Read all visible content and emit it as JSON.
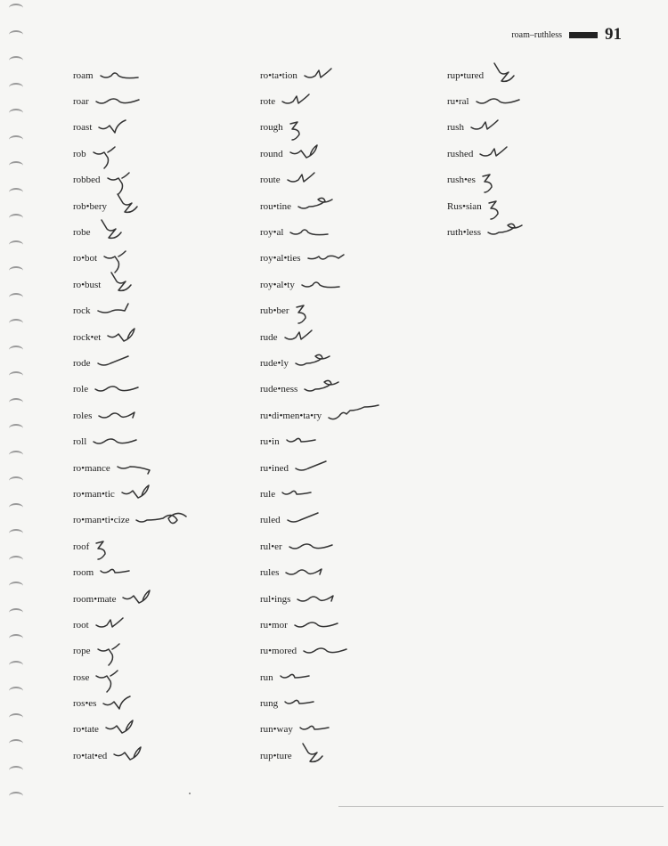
{
  "header": {
    "range": "roam–ruthless",
    "page_number": "91"
  },
  "columns": [
    [
      {
        "word": "roam",
        "stroke": "s1"
      },
      {
        "word": "roar",
        "stroke": "s2"
      },
      {
        "word": "roast",
        "stroke": "s3"
      },
      {
        "word": "rob",
        "stroke": "s4"
      },
      {
        "word": "robbed",
        "stroke": "s4"
      },
      {
        "word": "rob•bery",
        "stroke": "s5"
      },
      {
        "word": "robe",
        "stroke": "s5"
      },
      {
        "word": "ro•bot",
        "stroke": "s4"
      },
      {
        "word": "ro•bust",
        "stroke": "s5"
      },
      {
        "word": "rock",
        "stroke": "s6"
      },
      {
        "word": "rock•et",
        "stroke": "s7"
      },
      {
        "word": "rode",
        "stroke": "s8"
      },
      {
        "word": "role",
        "stroke": "s2"
      },
      {
        "word": "roles",
        "stroke": "s9"
      },
      {
        "word": "roll",
        "stroke": "s2"
      },
      {
        "word": "ro•mance",
        "stroke": "s10"
      },
      {
        "word": "ro•man•tic",
        "stroke": "s7"
      },
      {
        "word": "ro•man•ti•cize",
        "stroke": "s11"
      },
      {
        "word": "roof",
        "stroke": "s12"
      },
      {
        "word": "room",
        "stroke": "s13"
      },
      {
        "word": "room•mate",
        "stroke": "s7"
      },
      {
        "word": "root",
        "stroke": "s14"
      },
      {
        "word": "rope",
        "stroke": "s4"
      },
      {
        "word": "rose",
        "stroke": "s4"
      },
      {
        "word": "ros•es",
        "stroke": "s3"
      },
      {
        "word": "ro•tate",
        "stroke": "s7"
      },
      {
        "word": "ro•tat•ed",
        "stroke": "s7"
      }
    ],
    [
      {
        "word": "ro•ta•tion",
        "stroke": "s14"
      },
      {
        "word": "rote",
        "stroke": "s14"
      },
      {
        "word": "rough",
        "stroke": "s12"
      },
      {
        "word": "round",
        "stroke": "s7"
      },
      {
        "word": "route",
        "stroke": "s14"
      },
      {
        "word": "rou•tine",
        "stroke": "s15"
      },
      {
        "word": "roy•al",
        "stroke": "s1"
      },
      {
        "word": "roy•al•ties",
        "stroke": "s16"
      },
      {
        "word": "roy•al•ty",
        "stroke": "s1"
      },
      {
        "word": "rub•ber",
        "stroke": "s12"
      },
      {
        "word": "rude",
        "stroke": "s14"
      },
      {
        "word": "rude•ly",
        "stroke": "s15"
      },
      {
        "word": "rude•ness",
        "stroke": "s15"
      },
      {
        "word": "ru•di•men•ta•ry",
        "stroke": "s17"
      },
      {
        "word": "ru•in",
        "stroke": "s13"
      },
      {
        "word": "ru•ined",
        "stroke": "s8"
      },
      {
        "word": "rule",
        "stroke": "s13"
      },
      {
        "word": "ruled",
        "stroke": "s8"
      },
      {
        "word": "rul•er",
        "stroke": "s2"
      },
      {
        "word": "rules",
        "stroke": "s9"
      },
      {
        "word": "rul•ings",
        "stroke": "s9"
      },
      {
        "word": "ru•mor",
        "stroke": "s2"
      },
      {
        "word": "ru•mored",
        "stroke": "s2"
      },
      {
        "word": "run",
        "stroke": "s13"
      },
      {
        "word": "rung",
        "stroke": "s13"
      },
      {
        "word": "run•way",
        "stroke": "s13"
      },
      {
        "word": "rup•ture",
        "stroke": "s5"
      }
    ],
    [
      {
        "word": "rup•tured",
        "stroke": "s5"
      },
      {
        "word": "ru•ral",
        "stroke": "s2"
      },
      {
        "word": "rush",
        "stroke": "s14"
      },
      {
        "word": "rushed",
        "stroke": "s14"
      },
      {
        "word": "rush•es",
        "stroke": "s12"
      },
      {
        "word": "Rus•sian",
        "stroke": "s12"
      },
      {
        "word": "ruth•less",
        "stroke": "s15"
      }
    ]
  ]
}
